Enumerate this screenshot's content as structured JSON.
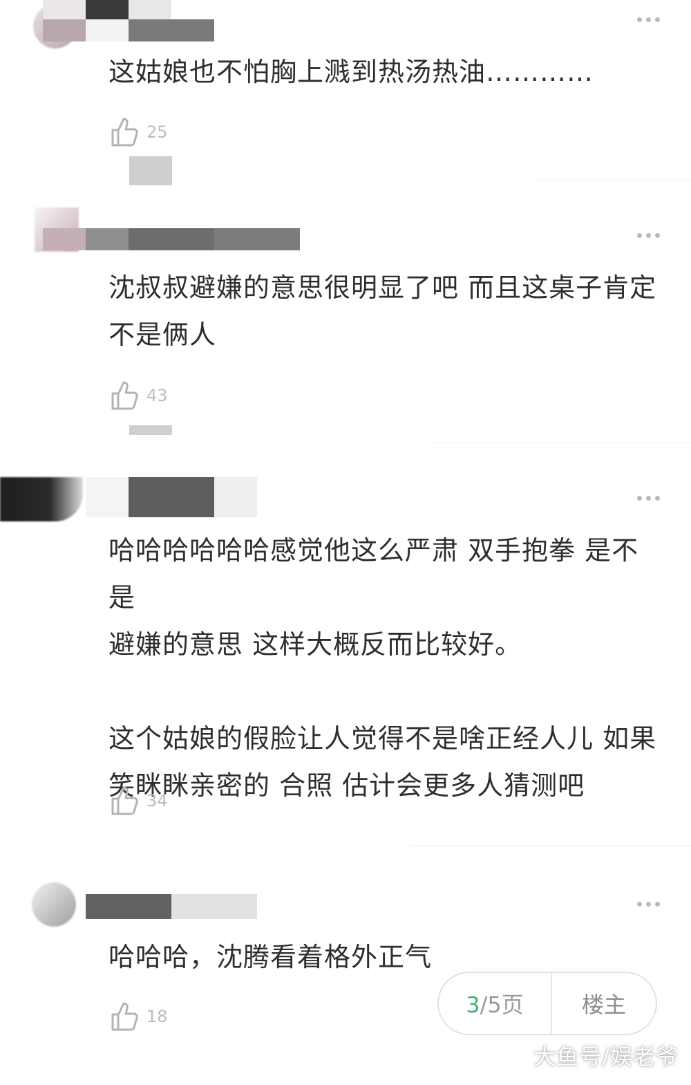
{
  "comments": [
    {
      "text_lines": [
        "这姑娘也不怕胸上溅到热汤热油…………"
      ],
      "likes": "25"
    },
    {
      "text_lines": [
        "沈叔叔避嫌的意思很明显了吧  而且这桌子肯定",
        "不是俩人"
      ],
      "likes": "43"
    },
    {
      "text_lines": [
        "哈哈哈哈哈哈感觉他这么严肃 双手抱拳 是不是",
        "避嫌的意思  这样大概反而比较好。",
        "",
        "这个姑娘的假脸让人觉得不是啥正经人儿 如果",
        "笑眯眯亲密的 合照 估计会更多人猜测吧"
      ],
      "likes": "34"
    },
    {
      "text_lines": [
        "哈哈哈，沈腾看着格外正气"
      ],
      "likes": "18"
    }
  ],
  "pager": {
    "current": "3",
    "rest": "/5页",
    "owner_label": "楼主"
  },
  "watermark": "大鱼号/娱老爷",
  "icons": {
    "like": "thumbs-up-icon",
    "more": "more-dots-icon"
  },
  "colors": {
    "accent": "#3eb475",
    "text": "#2e2e2e",
    "muted": "#bcbcbc"
  }
}
